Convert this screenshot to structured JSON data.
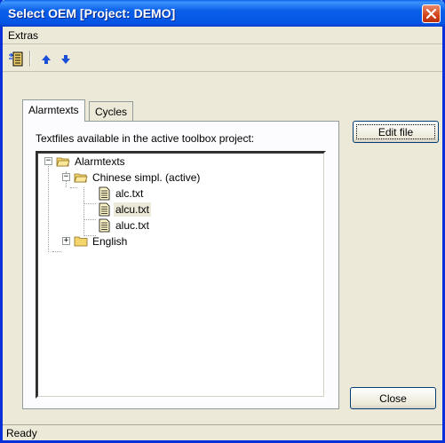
{
  "window": {
    "title": "Select OEM [Project: DEMO]"
  },
  "menu": {
    "items": [
      {
        "label": "Extras"
      }
    ]
  },
  "toolbar": {
    "buttons": [
      {
        "icon": "list-icon"
      },
      {
        "icon": "arrow-up-icon"
      },
      {
        "icon": "arrow-down-icon"
      }
    ]
  },
  "tabs": [
    {
      "label": "Alarmtexts",
      "active": true
    },
    {
      "label": "Cycles",
      "active": false
    }
  ],
  "panel": {
    "label": "Textfiles available in the active toolbox project:"
  },
  "tree": {
    "root": "Alarmtexts",
    "folder1": "Chinese simpl. (active)",
    "files": [
      "alc.txt",
      "alcu.txt",
      "aluc.txt"
    ],
    "selected_file": "alcu.txt",
    "folder2": "English"
  },
  "buttons": {
    "edit": "Edit file",
    "close": "Close"
  },
  "status": {
    "text": "Ready"
  },
  "colors": {
    "titlebar": "#0a5fe8",
    "window_border": "#0831d9",
    "close_button": "#d1421b",
    "arrow": "#1a4fd8"
  }
}
